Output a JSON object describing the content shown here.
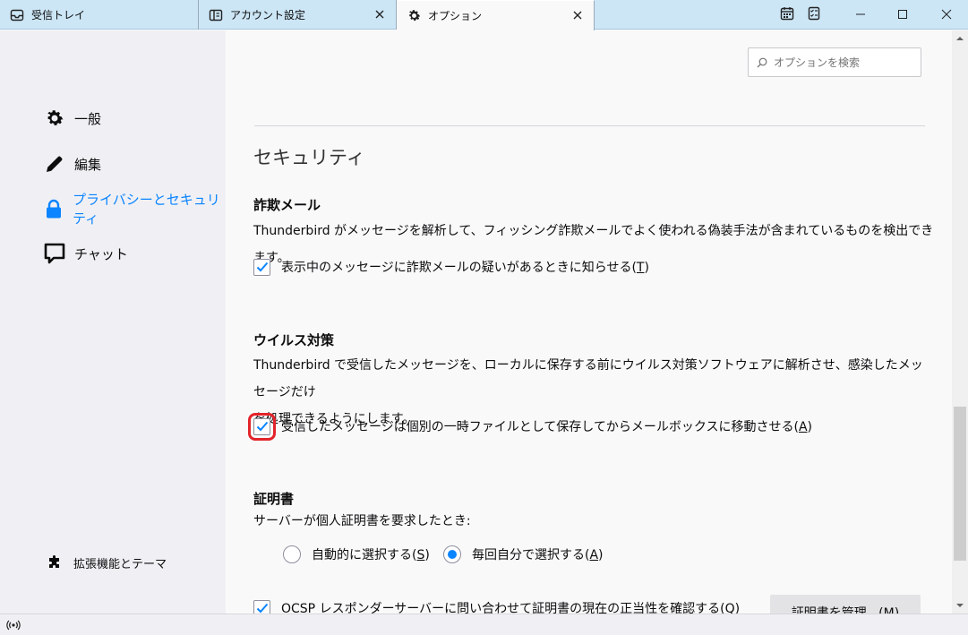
{
  "tabs": [
    {
      "label": "受信トレイ",
      "icon": "inbox-icon"
    },
    {
      "label": "アカウント設定",
      "icon": "account-settings-icon"
    },
    {
      "label": "オプション",
      "icon": "gear-icon"
    }
  ],
  "window_controls": {
    "calendar": "calendar-icon",
    "tasks": "tasks-icon",
    "minimize": "minimize-icon",
    "maximize": "maximize-icon",
    "close": "close-icon"
  },
  "sidebar": {
    "items": [
      {
        "label": "一般",
        "icon": "gear-icon"
      },
      {
        "label": "編集",
        "icon": "pencil-icon"
      },
      {
        "label": "プライバシーとセキュリティ",
        "icon": "lock-icon",
        "selected": true
      },
      {
        "label": "チャット",
        "icon": "chat-icon"
      }
    ],
    "extensions": {
      "label": "拡張機能とテーマ",
      "icon": "puzzle-icon"
    }
  },
  "search": {
    "placeholder": "オプションを検索"
  },
  "section": {
    "title": "セキュリティ"
  },
  "phishing": {
    "heading": "詐欺メール",
    "description": "Thunderbird がメッセージを解析して、フィッシング詐欺メールでよく使われる偽装手法が含まれているものを検出できます。",
    "checkbox_label": "表示中のメッセージに詐欺メールの疑いがあるときに知らせる",
    "checkbox_key": "T",
    "checked": true
  },
  "antivirus": {
    "heading": "ウイルス対策",
    "description_line1": "Thunderbird で受信したメッセージを、ローカルに保存する前にウイルス対策ソフトウェアに解析させ、感染したメッセージだけ",
    "description_line2": "を処理できるようにします。",
    "checkbox_label": "受信したメッセージは個別の一時ファイルとして保存してからメールボックスに移動させる",
    "checkbox_key": "A",
    "checked": true
  },
  "certificates": {
    "heading": "証明書",
    "description": "サーバーが個人証明書を要求したとき:",
    "radio_auto": "自動的に選択する",
    "radio_auto_key": "S",
    "radio_ask": "毎回自分で選択する",
    "radio_ask_key": "A",
    "selected": "ask",
    "ocsp_label": "OCSP レスポンダーサーバーに問い合わせて証明書の現在の正当性を確認する",
    "ocsp_key": "Q",
    "ocsp_checked": true,
    "manage_button": "証明書を管理...(M)"
  },
  "colors": {
    "accent": "#0a84ff",
    "highlight": "#e3242b",
    "tabbar": "#cce6f6"
  }
}
